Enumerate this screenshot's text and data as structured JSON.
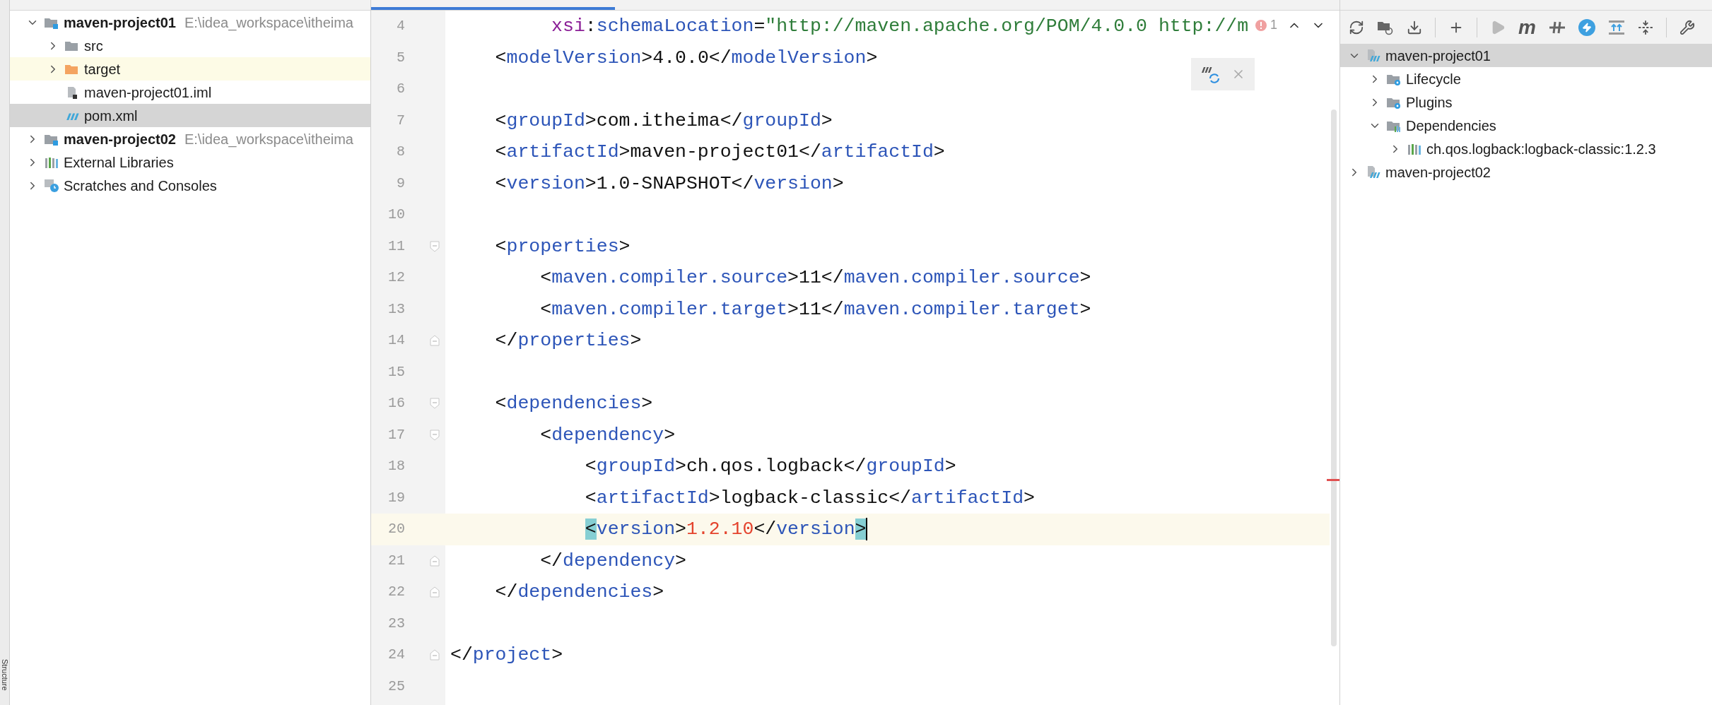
{
  "project_tree": [
    {
      "label": "maven-project01",
      "path": "E:\\idea_workspace\\itheima",
      "kind": "module",
      "expanded": true,
      "selected": false,
      "children": [
        {
          "label": "src",
          "kind": "folder",
          "expanded": false,
          "selected": false
        },
        {
          "label": "target",
          "kind": "excluded-folder",
          "expanded": false,
          "selected": false
        },
        {
          "label": "maven-project01.iml",
          "kind": "iml",
          "selected": false
        },
        {
          "label": "pom.xml",
          "kind": "maven-file",
          "selected": true
        }
      ]
    },
    {
      "label": "maven-project02",
      "path": "E:\\idea_workspace\\itheima",
      "kind": "module",
      "expanded": false,
      "selected": false
    },
    {
      "label": "External Libraries",
      "kind": "libraries",
      "expanded": false,
      "selected": false
    },
    {
      "label": "Scratches and Consoles",
      "kind": "scratches",
      "expanded": false,
      "selected": false
    }
  ],
  "side_stripe": {
    "bottom_label": "Structure"
  },
  "editor": {
    "problems": {
      "count": "1"
    },
    "lines": [
      {
        "number": "4",
        "current": false,
        "tokens": [
          {
            "kind": "ns",
            "text": "         xsi"
          },
          {
            "kind": "bracket",
            "text": ":"
          },
          {
            "kind": "attr",
            "text": "schemaLocation"
          },
          {
            "kind": "bracket",
            "text": "="
          },
          {
            "kind": "string",
            "text": "\"http://maven.apache.org/POM/4.0.0 http://m"
          }
        ]
      },
      {
        "number": "5",
        "current": false,
        "tokens": [
          {
            "kind": "bracket",
            "text": "    <"
          },
          {
            "kind": "tag",
            "text": "modelVersion"
          },
          {
            "kind": "bracket",
            "text": ">"
          },
          {
            "kind": "text",
            "text": "4.0.0"
          },
          {
            "kind": "bracket",
            "text": "</"
          },
          {
            "kind": "tag",
            "text": "modelVersion"
          },
          {
            "kind": "bracket",
            "text": ">"
          }
        ]
      },
      {
        "number": "6",
        "current": false
      },
      {
        "number": "7",
        "current": false,
        "tokens": [
          {
            "kind": "bracket",
            "text": "    <"
          },
          {
            "kind": "tag",
            "text": "groupId"
          },
          {
            "kind": "bracket",
            "text": ">"
          },
          {
            "kind": "text",
            "text": "com.itheima"
          },
          {
            "kind": "bracket",
            "text": "</"
          },
          {
            "kind": "tag",
            "text": "groupId"
          },
          {
            "kind": "bracket",
            "text": ">"
          }
        ]
      },
      {
        "number": "8",
        "current": false,
        "tokens": [
          {
            "kind": "bracket",
            "text": "    <"
          },
          {
            "kind": "tag",
            "text": "artifactId"
          },
          {
            "kind": "bracket",
            "text": ">"
          },
          {
            "kind": "text",
            "text": "maven-project01"
          },
          {
            "kind": "bracket",
            "text": "</"
          },
          {
            "kind": "tag",
            "text": "artifactId"
          },
          {
            "kind": "bracket",
            "text": ">"
          }
        ]
      },
      {
        "number": "9",
        "current": false,
        "tokens": [
          {
            "kind": "bracket",
            "text": "    <"
          },
          {
            "kind": "tag",
            "text": "version"
          },
          {
            "kind": "bracket",
            "text": ">"
          },
          {
            "kind": "text",
            "text": "1.0-SNAPSHOT"
          },
          {
            "kind": "bracket",
            "text": "</"
          },
          {
            "kind": "tag",
            "text": "version"
          },
          {
            "kind": "bracket",
            "text": ">"
          }
        ]
      },
      {
        "number": "10",
        "current": false
      },
      {
        "number": "11",
        "current": false,
        "kind": "fold-start",
        "tokens": [
          {
            "kind": "bracket",
            "text": "    <"
          },
          {
            "kind": "tag",
            "text": "properties"
          },
          {
            "kind": "bracket",
            "text": ">"
          }
        ]
      },
      {
        "number": "12",
        "current": false,
        "tokens": [
          {
            "kind": "bracket",
            "text": "        <"
          },
          {
            "kind": "tag",
            "text": "maven.compiler.source"
          },
          {
            "kind": "bracket",
            "text": ">"
          },
          {
            "kind": "text",
            "text": "11"
          },
          {
            "kind": "bracket",
            "text": "</"
          },
          {
            "kind": "tag",
            "text": "maven.compiler.source"
          },
          {
            "kind": "bracket",
            "text": ">"
          }
        ]
      },
      {
        "number": "13",
        "current": false,
        "tokens": [
          {
            "kind": "bracket",
            "text": "        <"
          },
          {
            "kind": "tag",
            "text": "maven.compiler.target"
          },
          {
            "kind": "bracket",
            "text": ">"
          },
          {
            "kind": "text",
            "text": "11"
          },
          {
            "kind": "bracket",
            "text": "</"
          },
          {
            "kind": "tag",
            "text": "maven.compiler.target"
          },
          {
            "kind": "bracket",
            "text": ">"
          }
        ]
      },
      {
        "number": "14",
        "current": false,
        "kind": "fold-end",
        "tokens": [
          {
            "kind": "bracket",
            "text": "    </"
          },
          {
            "kind": "tag",
            "text": "properties"
          },
          {
            "kind": "bracket",
            "text": ">"
          }
        ]
      },
      {
        "number": "15",
        "current": false
      },
      {
        "number": "16",
        "current": false,
        "kind": "fold-start",
        "tokens": [
          {
            "kind": "bracket",
            "text": "    <"
          },
          {
            "kind": "tag",
            "text": "dependencies"
          },
          {
            "kind": "bracket",
            "text": ">"
          }
        ]
      },
      {
        "number": "17",
        "current": false,
        "kind": "fold-start",
        "tokens": [
          {
            "kind": "bracket",
            "text": "        <"
          },
          {
            "kind": "tag",
            "text": "dependency"
          },
          {
            "kind": "bracket",
            "text": ">"
          }
        ]
      },
      {
        "number": "18",
        "current": false,
        "tokens": [
          {
            "kind": "bracket",
            "text": "            <"
          },
          {
            "kind": "tag",
            "text": "groupId"
          },
          {
            "kind": "bracket",
            "text": ">"
          },
          {
            "kind": "text",
            "text": "ch.qos.logback"
          },
          {
            "kind": "bracket",
            "text": "</"
          },
          {
            "kind": "tag",
            "text": "groupId"
          },
          {
            "kind": "bracket",
            "text": ">"
          }
        ]
      },
      {
        "number": "19",
        "current": false,
        "tokens": [
          {
            "kind": "bracket",
            "text": "            <"
          },
          {
            "kind": "tag",
            "text": "artifactId"
          },
          {
            "kind": "bracket",
            "text": ">"
          },
          {
            "kind": "text",
            "text": "logback-classic"
          },
          {
            "kind": "bracket",
            "text": "</"
          },
          {
            "kind": "tag",
            "text": "artifactId"
          },
          {
            "kind": "bracket",
            "text": ">"
          }
        ]
      },
      {
        "number": "20",
        "current": true,
        "tokens": [
          {
            "kind": "bracket-match",
            "text": "            <"
          },
          {
            "kind": "tag",
            "text": "version"
          },
          {
            "kind": "bracket",
            "text": ">"
          },
          {
            "kind": "value",
            "text": "1.2.10"
          },
          {
            "kind": "bracket",
            "text": "</"
          },
          {
            "kind": "tag",
            "text": "version"
          },
          {
            "kind": "bracket-match",
            "text": ">"
          }
        ]
      },
      {
        "number": "21",
        "current": false,
        "kind": "fold-end",
        "tokens": [
          {
            "kind": "bracket",
            "text": "        </"
          },
          {
            "kind": "tag",
            "text": "dependency"
          },
          {
            "kind": "bracket",
            "text": ">"
          }
        ]
      },
      {
        "number": "22",
        "current": false,
        "kind": "fold-end",
        "tokens": [
          {
            "kind": "bracket",
            "text": "    </"
          },
          {
            "kind": "tag",
            "text": "dependencies"
          },
          {
            "kind": "bracket",
            "text": ">"
          }
        ]
      },
      {
        "number": "23",
        "current": false
      },
      {
        "number": "24",
        "current": false,
        "kind": "fold-end",
        "tokens": [
          {
            "kind": "bracket",
            "text": "</"
          },
          {
            "kind": "tag",
            "text": "project"
          },
          {
            "kind": "bracket",
            "text": ">"
          }
        ]
      },
      {
        "number": "25",
        "current": false
      }
    ]
  },
  "maven_panel": {
    "toolbar": {
      "goal_glyph": "m"
    },
    "tree": [
      {
        "label": "maven-project01",
        "kind": "maven-project",
        "expanded": true,
        "selected": true,
        "children": [
          {
            "label": "Lifecycle",
            "kind": "lifecycle",
            "expanded": false,
            "selected": false
          },
          {
            "label": "Plugins",
            "kind": "plugins",
            "expanded": false,
            "selected": false
          },
          {
            "label": "Dependencies",
            "kind": "dependencies",
            "expanded": true,
            "selected": false,
            "children": [
              {
                "label": "ch.qos.logback:logback-classic:1.2.3",
                "kind": "library",
                "expanded": false,
                "selected": false
              }
            ]
          }
        ]
      },
      {
        "label": "maven-project02",
        "kind": "maven-project",
        "expanded": false,
        "selected": false
      }
    ]
  }
}
